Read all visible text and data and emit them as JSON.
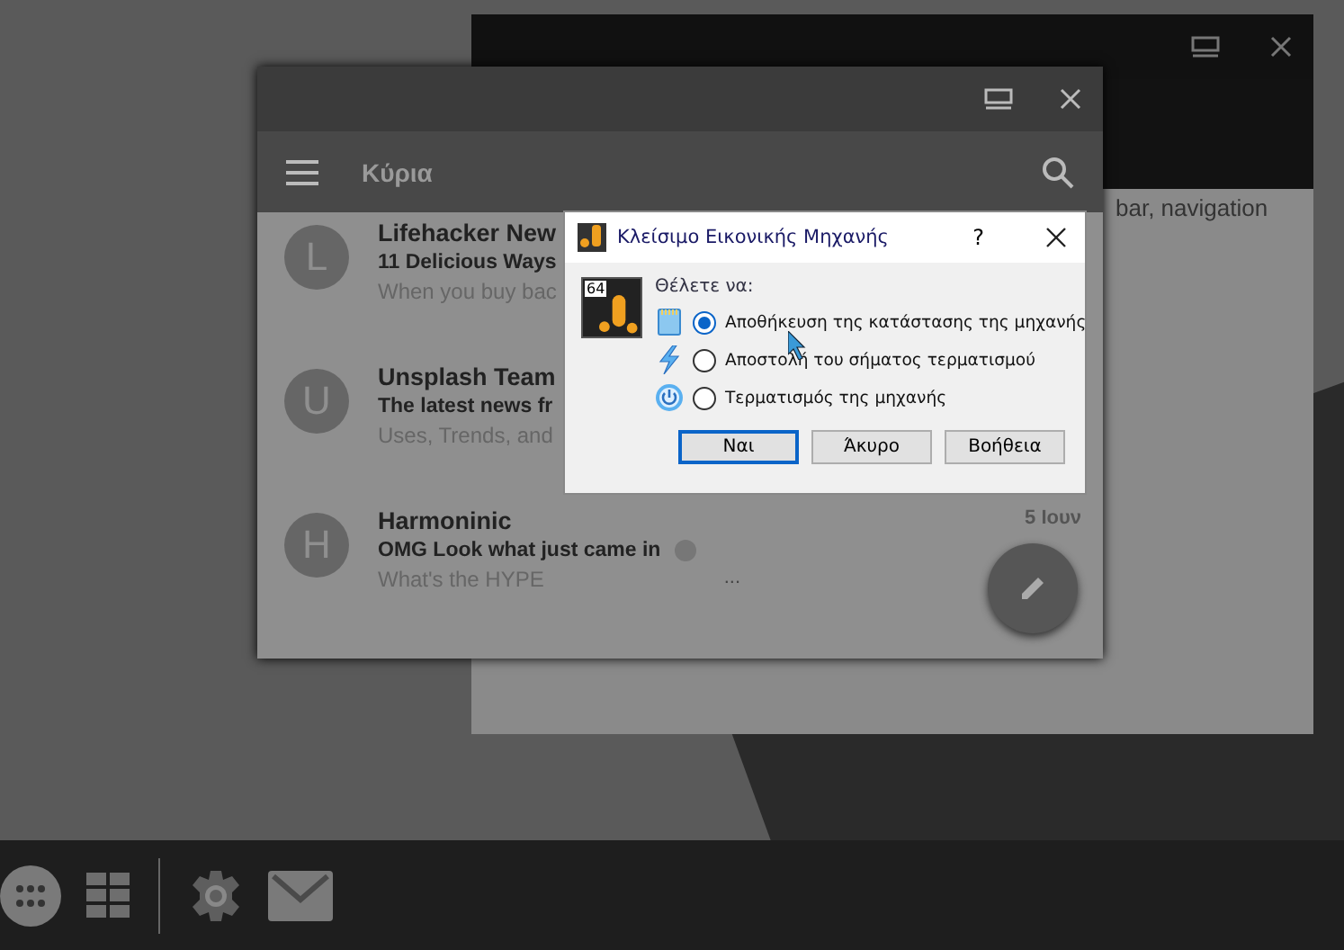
{
  "back_window": {
    "snippet": "bar, navigation"
  },
  "mail_window": {
    "toolbar_title": "Κύρια",
    "messages": [
      {
        "avatar": "L",
        "sender": "Lifehacker New",
        "subject": "11 Delicious Ways",
        "preview": "When you buy bac"
      },
      {
        "avatar": "U",
        "sender": "Unsplash Team",
        "subject": "The latest news fr",
        "preview": "Uses, Trends, and"
      },
      {
        "avatar": "H",
        "sender": "Harmoninic",
        "subject": "OMG Look what just came in",
        "preview": "What's the HYPE",
        "date": "5 Ιουν",
        "ellipsis": "..."
      }
    ]
  },
  "dialog": {
    "title": "Κλείσιμο Εικονικής Μηχανής",
    "help": "?",
    "badge": "64",
    "prompt": "Θέλετε να:",
    "options": [
      {
        "kind": "save",
        "label": "Αποθήκευση της κατάστασης της μηχανής",
        "selected": true
      },
      {
        "kind": "signal",
        "label": "Αποστολή του σήματος τερματισμού",
        "selected": false
      },
      {
        "kind": "power",
        "label": "Τερματισμός της μηχανής",
        "selected": false
      }
    ],
    "buttons": [
      {
        "label": "Ναι",
        "default": true
      },
      {
        "label": "Άκυρο",
        "default": false
      },
      {
        "label": "Βοήθεια",
        "default": false
      }
    ]
  }
}
